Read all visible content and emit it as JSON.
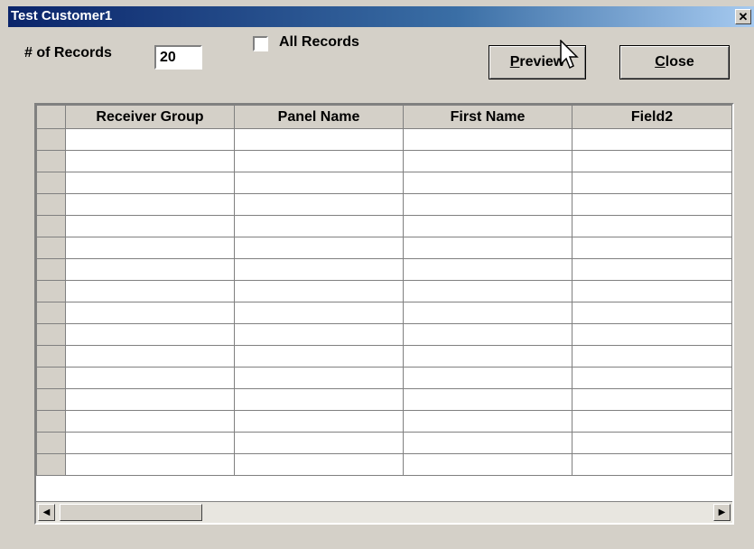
{
  "window": {
    "title": "Test Customer1",
    "close_glyph": "✕"
  },
  "controls": {
    "records_label": "# of Records",
    "records_value": "20",
    "all_records_label": "All Records",
    "all_records_checked": false
  },
  "buttons": {
    "preview_label": "Preview",
    "preview_mnemonic": "P",
    "close_label": "Close",
    "close_mnemonic": "C"
  },
  "grid": {
    "columns": [
      "Receiver Group",
      "Panel Name",
      "First Name",
      "Field2"
    ],
    "row_count": 16
  },
  "scrollbar": {
    "left_arrow": "◀",
    "right_arrow": "▶"
  }
}
